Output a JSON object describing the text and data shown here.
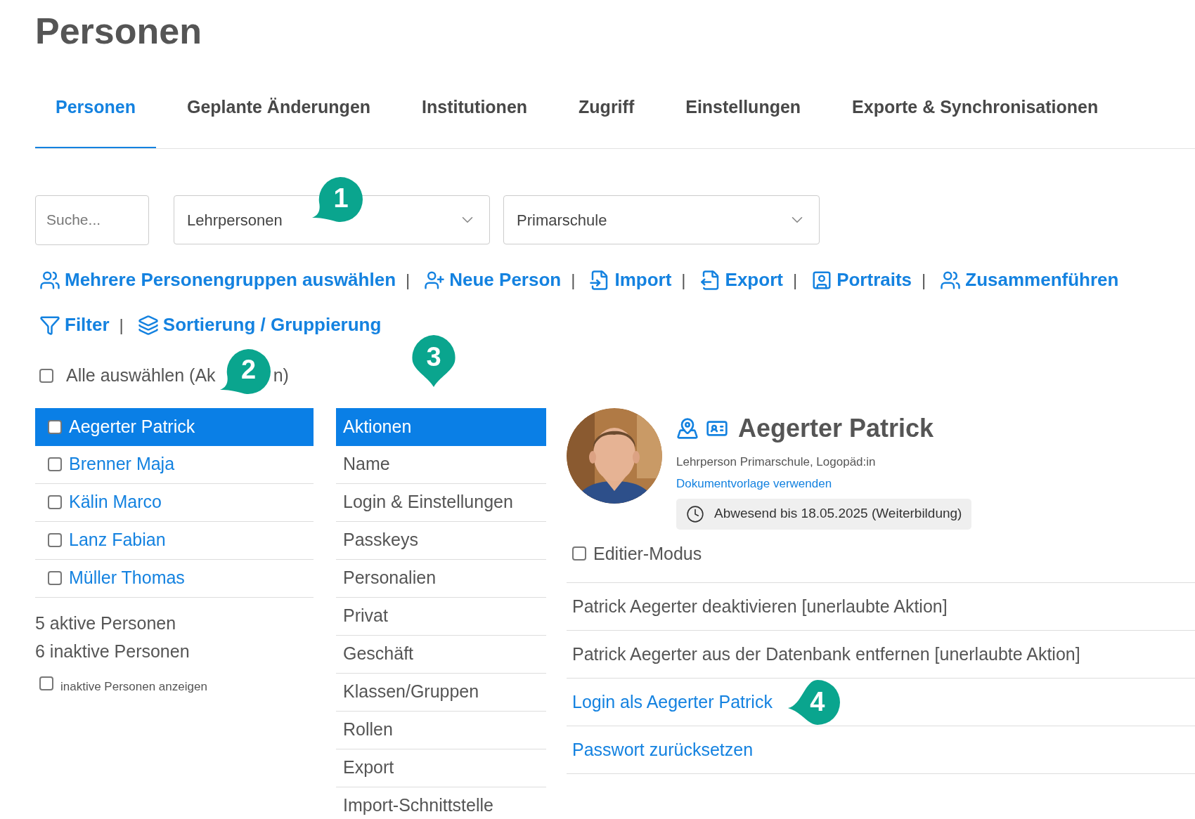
{
  "page_title": "Personen",
  "tabs": [
    {
      "label": "Personen",
      "selected": true
    },
    {
      "label": "Geplante Änderungen",
      "selected": false
    },
    {
      "label": "Institutionen",
      "selected": false
    },
    {
      "label": "Zugriff",
      "selected": false
    },
    {
      "label": "Einstellungen",
      "selected": false
    },
    {
      "label": "Exporte & Synchronisationen",
      "selected": false
    }
  ],
  "filters": {
    "search": {
      "placeholder": "Suche..."
    },
    "group_select": {
      "value": "Lehrpersonen",
      "callout": "1"
    },
    "school_select": {
      "value": "Primarschule"
    }
  },
  "toolbar_rows": [
    [
      {
        "label": "Mehrere Personengruppen auswählen",
        "kind": "groups"
      },
      {
        "label": "Neue Person",
        "kind": "new_person"
      },
      {
        "label": "Import",
        "kind": "import"
      },
      {
        "label": "Export",
        "kind": "export"
      },
      {
        "label": "Portraits",
        "kind": "portraits"
      },
      {
        "label": "Zusammenführen",
        "kind": "merge"
      }
    ],
    [
      {
        "label": "Filter",
        "kind": "filter"
      },
      {
        "label": "Sortierung / Gruppierung",
        "kind": "sort"
      }
    ]
  ],
  "separator": "|",
  "select_all": {
    "label_before": "Alle auswählen (Ak",
    "label_after": "n)",
    "callout": "2",
    "checked": false
  },
  "persons": [
    {
      "name": "Aegerter Patrick",
      "selected": true,
      "checked": false
    },
    {
      "name": "Brenner Maja",
      "selected": false,
      "checked": false
    },
    {
      "name": "Kälin Marco",
      "selected": false,
      "checked": false
    },
    {
      "name": "Lanz Fabian",
      "selected": false,
      "checked": false
    },
    {
      "name": "Müller Thomas",
      "selected": false,
      "checked": false
    }
  ],
  "summary": [
    "5 aktive Personen",
    "6 inaktive Personen"
  ],
  "show_inactive": {
    "label": "inaktive Personen anzeigen",
    "checked": false
  },
  "menu": {
    "callout": "3",
    "items": [
      {
        "label": "Aktionen",
        "selected": true
      },
      {
        "label": "Name",
        "selected": false
      },
      {
        "label": "Login & Einstellungen",
        "selected": false
      },
      {
        "label": "Passkeys",
        "selected": false
      },
      {
        "label": "Personalien",
        "selected": false
      },
      {
        "label": "Privat",
        "selected": false
      },
      {
        "label": "Geschäft",
        "selected": false
      },
      {
        "label": "Klassen/Gruppen",
        "selected": false
      },
      {
        "label": "Rollen",
        "selected": false
      },
      {
        "label": "Export",
        "selected": false
      },
      {
        "label": "Import-Schnittstelle",
        "selected": false
      }
    ]
  },
  "profile": {
    "name": "Aegerter Patrick",
    "subtitle": "Lehrperson Primarschule, Logopäd:in",
    "link": "Dokumentvorlage verwenden",
    "absence": "Abwesend bis 18.05.2025 (Weiterbildung)",
    "edit_mode": {
      "label": "Editier-Modus",
      "checked": false
    }
  },
  "actions": [
    {
      "label": "Patrick Aegerter deaktivieren [unerlaubte Aktion]",
      "disabled": true
    },
    {
      "label": "Patrick Aegerter aus der Datenbank entfernen [unerlaubte Aktion]",
      "disabled": true
    },
    {
      "label": "Login als Aegerter Patrick",
      "disabled": false,
      "callout": "4"
    },
    {
      "label": "Passwort zurücksetzen",
      "disabled": false
    }
  ]
}
